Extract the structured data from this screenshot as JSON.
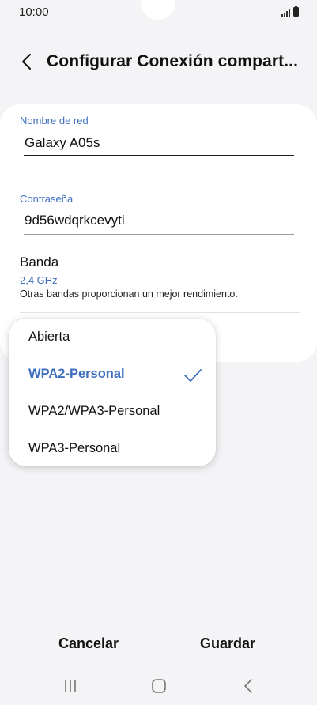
{
  "status_bar": {
    "time": "10:00",
    "icons": [
      "signal-icon",
      "battery-icon"
    ]
  },
  "header": {
    "back_icon": "chevron-left-icon",
    "title": "Configurar Conexión compart..."
  },
  "form": {
    "network_name": {
      "label": "Nombre de red",
      "value": "Galaxy A05s"
    },
    "password": {
      "label": "Contraseña",
      "value": "9d56wdqrkcevyti"
    },
    "band": {
      "title": "Banda",
      "value": "2,4 GHz",
      "description": "Otras bandas proporcionan un mejor rendimiento."
    }
  },
  "security_dropdown": {
    "selected_index": 1,
    "options": [
      {
        "label": "Abierta"
      },
      {
        "label": "WPA2-Personal"
      },
      {
        "label": "WPA2/WPA3-Personal"
      },
      {
        "label": "WPA3-Personal"
      }
    ]
  },
  "actions": {
    "cancel_label": "Cancelar",
    "save_label": "Guardar"
  },
  "nav_bar": {
    "icons": [
      "recents-icon",
      "home-icon",
      "back-icon"
    ]
  },
  "colors": {
    "accent": "#3e6fbf",
    "background": "#f4f4f6",
    "card": "#ffffff",
    "text": "#111111"
  }
}
